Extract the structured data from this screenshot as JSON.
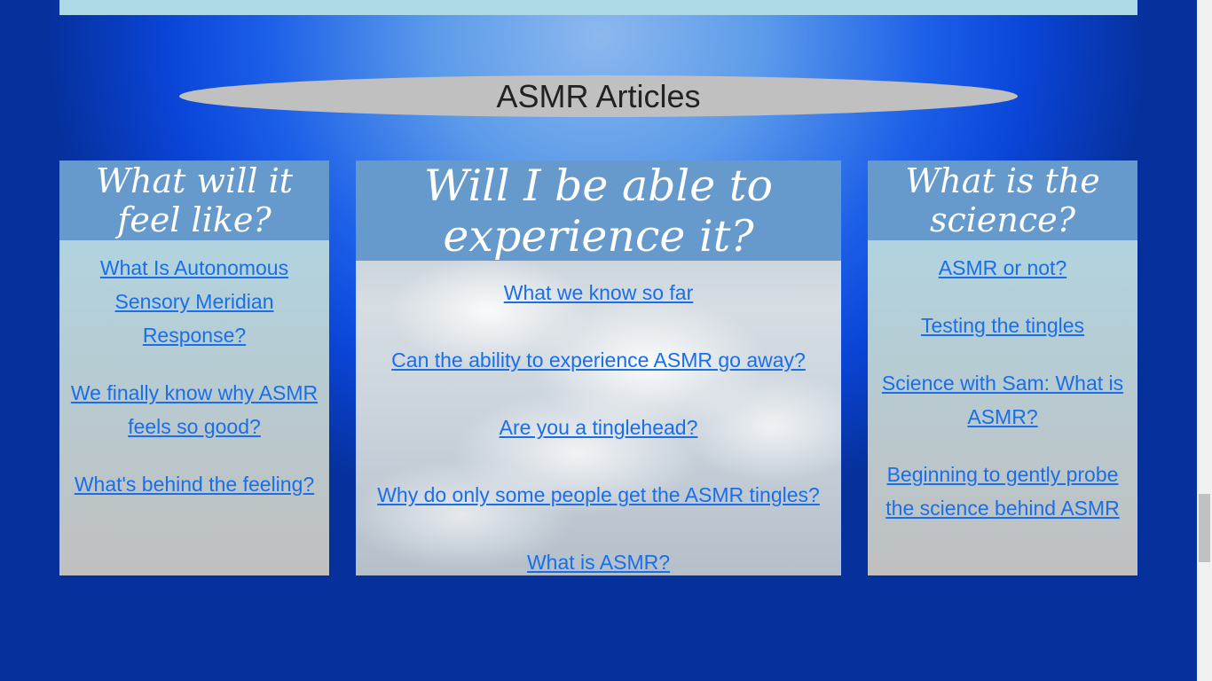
{
  "page": {
    "section_title": "ASMR Articles"
  },
  "panels": {
    "left": {
      "heading": "What will it feel like?",
      "links": [
        "What Is Autonomous Sensory Meridian Response?",
        "We finally know why ASMR feels so good?",
        "What's behind the feeling?"
      ]
    },
    "middle": {
      "heading": "Will I be able to experience it?",
      "links": [
        "What we know so far",
        "Can the ability to experience ASMR go away?",
        "Are you a tinglehead?",
        "Why do only some people get the ASMR tingles?",
        "What is ASMR?"
      ]
    },
    "right": {
      "heading": "What is the science?",
      "links": [
        "ASMR or not?",
        "Testing the tingles",
        "Science with Sam: What is ASMR?",
        "Beginning to gently probe the science behind ASMR"
      ]
    }
  },
  "colors": {
    "panel_heading_bg": "#6699cc",
    "link": "#1a6ee8",
    "title_pill": "#c0c0c0",
    "top_strip": "#add8e6"
  }
}
